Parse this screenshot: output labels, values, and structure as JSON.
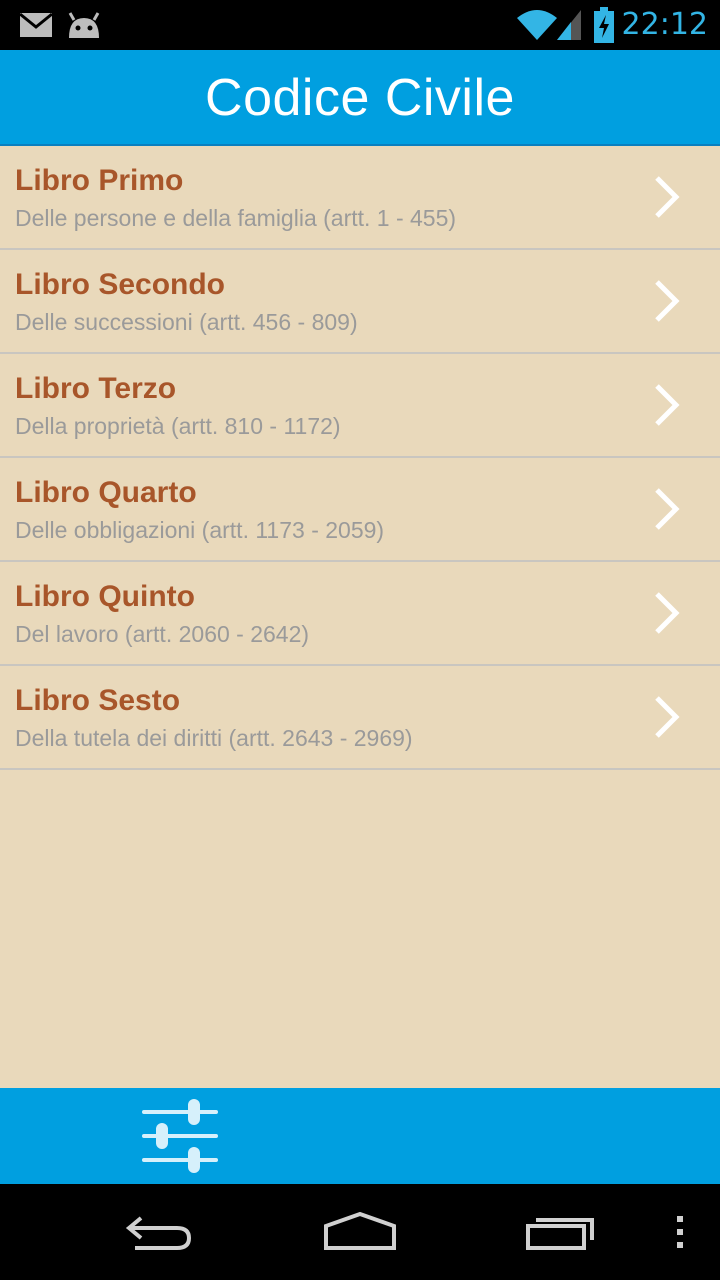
{
  "status_bar": {
    "time": "22:12",
    "icons": [
      "mail-icon",
      "android-icon",
      "wifi-icon",
      "signal-icon",
      "battery-charging-icon"
    ]
  },
  "action_bar": {
    "title": "Codice Civile"
  },
  "books": [
    {
      "title": "Libro Primo",
      "subtitle": "Delle persone e della famiglia (artt. 1 - 455)"
    },
    {
      "title": "Libro Secondo",
      "subtitle": "Delle successioni (artt. 456 - 809)"
    },
    {
      "title": "Libro Terzo",
      "subtitle": "Della proprietà (artt. 810 - 1172)"
    },
    {
      "title": "Libro Quarto",
      "subtitle": "Delle obbligazioni (artt. 1173 - 2059)"
    },
    {
      "title": "Libro Quinto",
      "subtitle": "Del lavoro (artt. 2060 - 2642)"
    },
    {
      "title": "Libro Sesto",
      "subtitle": "Della tutela dei diritti (artt. 2643 - 2969)"
    }
  ],
  "bottom_toolbar": {
    "icon": "settings-sliders-icon"
  },
  "nav_bar": {
    "icons": [
      "back-icon",
      "home-icon",
      "recents-icon",
      "overflow-menu-icon"
    ]
  },
  "colors": {
    "accent": "#009fe0",
    "background": "#e9d9bb",
    "title_text": "#a8562a",
    "subtitle_text": "#9a9a9a",
    "clock": "#33b5e5"
  }
}
